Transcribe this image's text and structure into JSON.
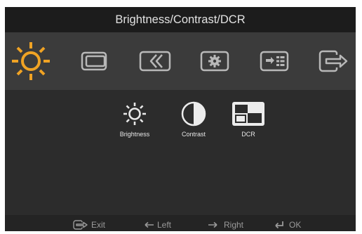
{
  "window": {
    "title": "Brightness/Contrast/DCR"
  },
  "tabs": [
    {
      "icon": "brightness-sun-icon",
      "selected": true
    },
    {
      "icon": "image-position-icon",
      "selected": false
    },
    {
      "icon": "image-setup-icon",
      "selected": false
    },
    {
      "icon": "options-gear-icon",
      "selected": false
    },
    {
      "icon": "input-signal-list-icon",
      "selected": false
    },
    {
      "icon": "exit-icon",
      "selected": false
    }
  ],
  "submenu": {
    "items": [
      {
        "label": "Brightness",
        "icon": "brightness-sun-icon"
      },
      {
        "label": "Contrast",
        "icon": "contrast-icon"
      },
      {
        "label": "DCR",
        "icon": "dcr-icon"
      }
    ]
  },
  "footer": {
    "exit_label": "Exit",
    "left_label": "Left",
    "right_label": "Right",
    "ok_label": "OK"
  },
  "colors": {
    "accent": "#f0a324",
    "icon": "#b8b8b8",
    "text": "#e6e6e6",
    "footer_text": "#9a9a9a"
  }
}
